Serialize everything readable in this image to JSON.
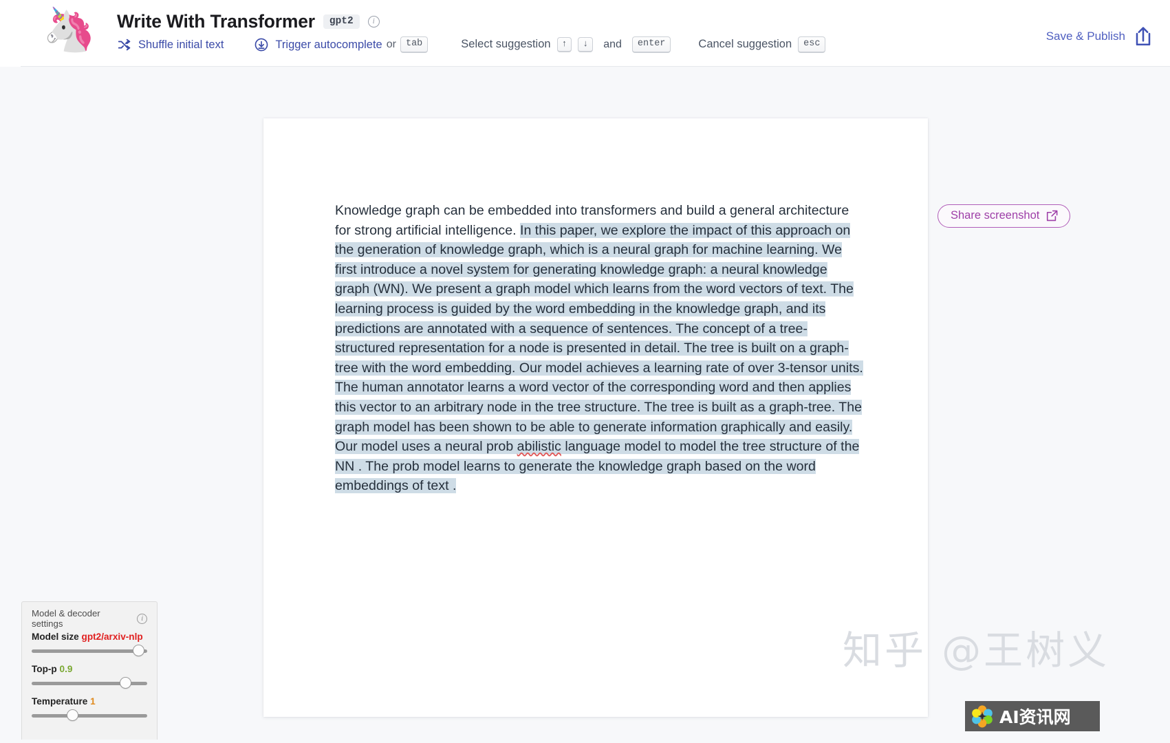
{
  "header": {
    "logo_icon": "unicorn-emoji",
    "logo_glyph": "🦄",
    "title": "Write With Transformer",
    "model_badge": "gpt2",
    "info_icon": "info-icon",
    "hints": [
      {
        "icon": "shuffle-icon",
        "label": "Shuffle initial text",
        "keys": []
      },
      {
        "icon": "download-circle-icon",
        "label": "Trigger autocomplete",
        "connector": "or",
        "keys": [
          "tab"
        ]
      },
      {
        "icon": "",
        "label": "Select suggestion",
        "keys": [
          "↑",
          "↓"
        ],
        "connector2": "and",
        "keys2": [
          "enter"
        ]
      },
      {
        "icon": "",
        "label": "Cancel suggestion",
        "keys": [
          "esc"
        ]
      }
    ],
    "hint_labels": {
      "shuffle": "Shuffle initial text",
      "autocomplete": "Trigger autocomplete",
      "or": "or",
      "tab": "tab",
      "select": "Select suggestion",
      "up": "↑",
      "down": "↓",
      "and": "and",
      "enter": "enter",
      "cancel": "Cancel suggestion",
      "esc": "esc"
    },
    "publish_label": "Save & Publish",
    "publish_icon": "upload-icon"
  },
  "document": {
    "seed_text": "Knowledge graph can be embedded into transformers and build a general architecture for strong artificial intelligence. ",
    "generated_text": " In this paper, we explore the impact of this approach on the generation of knowledge graph, which is a neural graph for machine learning. We first introduce a novel system for generating knowledge graph: a neural knowledge graph (WN).  We present a graph model which learns from the word vectors of text. The learning process is guided by the word embedding in the knowledge graph, and its predictions are annotated with  a sequence of sentences. The concept of a tree-structured representation for a node is presented in detail. The tree is built on a graph-tree with the word embedding. Our model achieves a learning rate of over 3-tensor units. The human annotator learns a word vector of the corresponding  word and then applies this vector to an arbitrary node in the tree structure. The tree is built as a graph-tree. The graph model has been shown to be able to generate information graphically and easily. Our model uses a neural prob abilistic language model to model the tree structure of the NN . The prob model learns  to generate the knowledge graph based on the word embeddings of text .",
    "misspelled_word": "abilistic",
    "highlight_color": "#cedce6"
  },
  "share": {
    "label": "Share screenshot",
    "icon": "external-link-icon",
    "accent_color": "#9e3fa8"
  },
  "settings": {
    "panel_title": "Model & decoder settings",
    "info_icon": "info-icon",
    "controls": [
      {
        "label": "Model size",
        "value": "gpt2/arxiv-nlp",
        "value_color": "#e02020",
        "thumb_percent": 92
      },
      {
        "label": "Top-p",
        "value": "0.9",
        "value_color": "#7aa832",
        "thumb_percent": 81
      },
      {
        "label": "Temperature",
        "value": "1",
        "value_color": "#e08a1e",
        "thumb_percent": 35
      }
    ]
  },
  "watermark": {
    "text": "知乎 @王树义",
    "badge_text": "AI资讯网",
    "badge_icon": "flower-logo-icon"
  }
}
